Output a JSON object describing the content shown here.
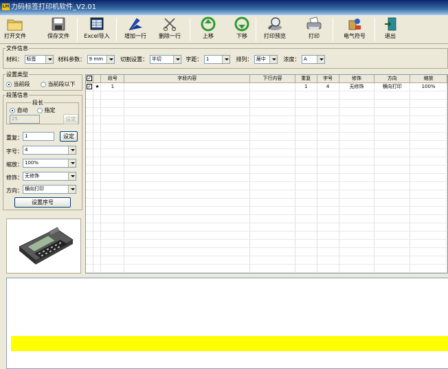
{
  "title": {
    "app_icon": "LM",
    "text": "力码标签打印机软件_V2.01"
  },
  "toolbar": [
    {
      "label": "打开文件",
      "icon": "folder-open-icon"
    },
    {
      "label": "保存文件",
      "icon": "floppy-disk-icon"
    },
    {
      "label": "Excel导入",
      "icon": "excel-import-icon"
    },
    {
      "label": "增加一行",
      "icon": "pen-add-icon"
    },
    {
      "label": "删除一行",
      "icon": "scissors-delete-icon"
    },
    {
      "label": "上移",
      "icon": "arrow-up-icon"
    },
    {
      "label": "下移",
      "icon": "arrow-down-icon"
    },
    {
      "label": "打印预览",
      "icon": "magnifier-preview-icon"
    },
    {
      "label": "打印",
      "icon": "printer-icon"
    },
    {
      "label": "电气符号",
      "icon": "electrical-symbol-icon"
    },
    {
      "label": "退出",
      "icon": "exit-door-icon"
    }
  ],
  "file_info": {
    "group_title": "文件信息",
    "material_label": "材料：",
    "material_value": "标签",
    "material_param_label": "材料参数：",
    "material_param_value": "9 mm",
    "cut_label": "切割设置：",
    "cut_value": "半切",
    "spacing_label": "字距：",
    "spacing_value": "1",
    "align_label": "排列：",
    "align_value": "居中",
    "density_label": "浓度：",
    "density_value": "A"
  },
  "settings_type": {
    "group_title": "设置类型",
    "option_current": "当前段",
    "option_current_below": "当前段以下",
    "selected": "当前段"
  },
  "segment_info": {
    "group_title": "段落信息",
    "length_title": "段长",
    "auto_label": "自动",
    "manual_label": "指定",
    "selected": "自动",
    "length_value": "25",
    "length_set_button": "设定",
    "repeat_label": "重复：",
    "repeat_value": "1",
    "repeat_set_button": "设定",
    "font_size_label": "字号：",
    "font_size_value": "4",
    "scale_label": "缩放：",
    "scale_value": "100%",
    "decoration_label": "修饰：",
    "decoration_value": "无修饰",
    "direction_label": "方向：",
    "direction_value": "横向打印",
    "serial_button": "设置序号"
  },
  "grid": {
    "columns": [
      "",
      "",
      "段号",
      "字段内容",
      "下行内容",
      "重复",
      "字号",
      "修饰",
      "方向",
      "缩放"
    ],
    "rows": [
      {
        "checked": true,
        "marker": "★",
        "index": "1",
        "content": "",
        "next_line": "",
        "repeat": "1",
        "font_size": "4",
        "decoration": "无修饰",
        "direction": "横向打印",
        "scale": "100%"
      }
    ],
    "empty_rows": 23
  },
  "colors": {
    "preview_highlight": "#ffff00",
    "title_bar": "#0a246a"
  }
}
